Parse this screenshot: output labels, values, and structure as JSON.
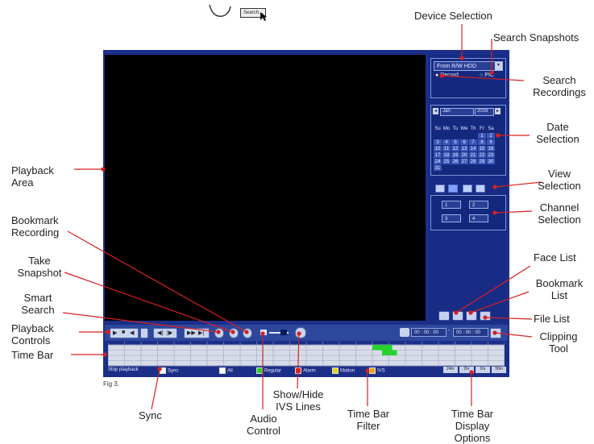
{
  "top_icons": {
    "mini_search_label": "Search..."
  },
  "device_selection": {
    "value": "From R/W HDD"
  },
  "search_type": {
    "record_label": "Record",
    "pic_label": "PIC"
  },
  "calendar": {
    "month": "Jan",
    "year": "2016",
    "weekdays": [
      "Su",
      "Mo",
      "Tu",
      "We",
      "Th",
      "Fr",
      "Sa"
    ],
    "weeks": [
      [
        "",
        "",
        "",
        "",
        "",
        "1",
        "2"
      ],
      [
        "3",
        "4",
        "5",
        "6",
        "7",
        "8",
        "9"
      ],
      [
        "10",
        "11",
        "12",
        "13",
        "14",
        "15",
        "16"
      ],
      [
        "17",
        "18",
        "19",
        "20",
        "21",
        "22",
        "23"
      ],
      [
        "24",
        "25",
        "26",
        "27",
        "28",
        "29",
        "30"
      ],
      [
        "31",
        "",
        "",
        "",
        "",
        "",
        ""
      ]
    ]
  },
  "channels": [
    "1",
    "2",
    "3",
    "4"
  ],
  "control_bar": {
    "time_start": "00 : 00 : 00",
    "time_sep": "-",
    "time_end": "00 : 00 : 00"
  },
  "status_row": {
    "stop_playback": "Stop playback",
    "sync": "Sync",
    "all": "All",
    "regular": "Regular",
    "alarm": "Alarm",
    "motion": "Motion",
    "ivs": "IVS",
    "display_options": [
      "24hr",
      "2hr",
      "1hr",
      "30m"
    ]
  },
  "figure_caption": "Fig 3.",
  "colors": {
    "record_green": "#27d22d",
    "alarm_red": "#e02020",
    "motion_yellow": "#e6d21a",
    "regular_green": "#27d22d"
  },
  "labels": {
    "device_selection": "Device Selection",
    "search_snapshots": "Search Snapshots",
    "search_recordings_1": "Search",
    "search_recordings_2": "Recordings",
    "date_selection_1": "Date",
    "date_selection_2": "Selection",
    "view_selection_1": "View",
    "view_selection_2": "Selection",
    "channel_selection_1": "Channel",
    "channel_selection_2": "Selection",
    "face_list": "Face List",
    "bookmark_list_1": "Bookmark",
    "bookmark_list_2": "List",
    "file_list": "File List",
    "clipping_tool_1": "Clipping",
    "clipping_tool_2": "Tool",
    "playback_area_1": "Playback",
    "playback_area_2": "Area",
    "bookmark_recording_1": "Bookmark",
    "bookmark_recording_2": "Recording",
    "take_snapshot_1": "Take",
    "take_snapshot_2": "Snapshot",
    "smart_search_1": "Smart",
    "smart_search_2": "Search",
    "playback_controls_1": "Playback",
    "playback_controls_2": "Controls",
    "time_bar": "Time Bar",
    "sync": "Sync",
    "audio_control_1": "Audio",
    "audio_control_2": "Control",
    "show_hide_ivs_1": "Show/Hide",
    "show_hide_ivs_2": "IVS Lines",
    "time_bar_filter_1": "Time Bar",
    "time_bar_filter_2": "Filter",
    "time_bar_display_1": "Time Bar",
    "time_bar_display_2": "Display",
    "time_bar_display_3": "Options"
  }
}
